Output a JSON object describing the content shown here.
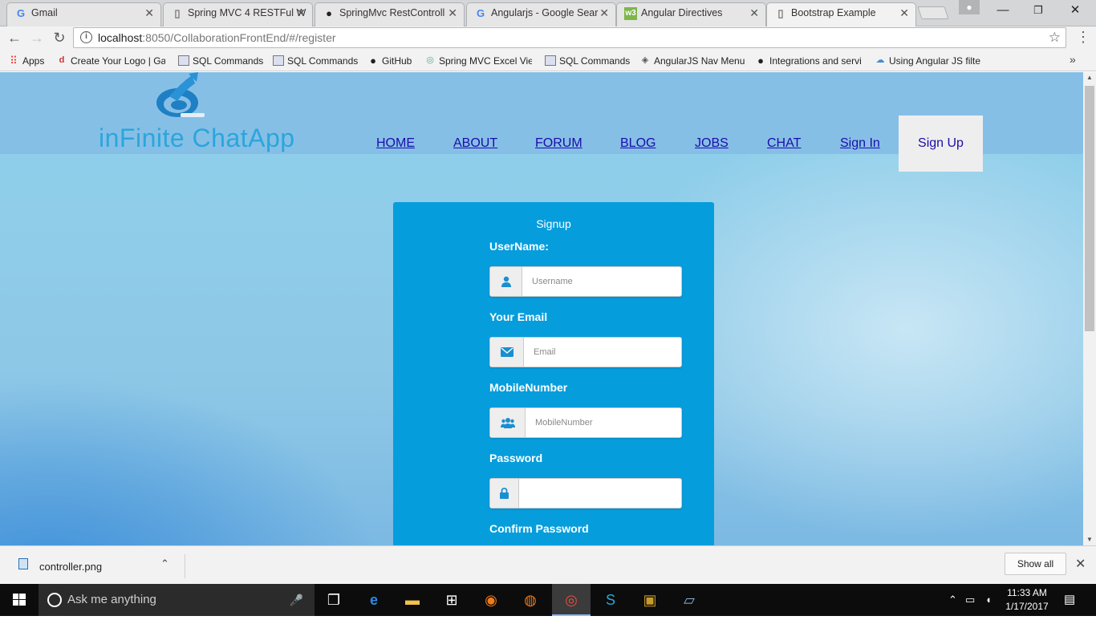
{
  "tabs": [
    {
      "icon": "google-icon",
      "label": "Gmail"
    },
    {
      "icon": "document-icon",
      "label": "Spring MVC 4 RESTFul W"
    },
    {
      "icon": "github-icon",
      "label": "SpringMvc RestControll"
    },
    {
      "icon": "google-icon",
      "label": "Angularjs - Google Sear"
    },
    {
      "icon": "w3-icon",
      "label": "Angular Directives"
    },
    {
      "icon": "document-icon",
      "label": "Bootstrap Example"
    }
  ],
  "address": {
    "host": "localhost",
    "path": ":8050/CollaborationFrontEnd/#/register"
  },
  "bookmarks": [
    {
      "label": "Apps"
    },
    {
      "label": "Create Your Logo | Ga"
    },
    {
      "label": "SQL Commands"
    },
    {
      "label": "SQL Commands"
    },
    {
      "label": "GitHub"
    },
    {
      "label": "Spring MVC Excel View"
    },
    {
      "label": "SQL Commands"
    },
    {
      "label": "AngularJS Nav Menu"
    },
    {
      "label": "Integrations and servi"
    },
    {
      "label": "Using Angular JS filte"
    }
  ],
  "site": {
    "logo_text": "inFinite ChatApp",
    "nav": [
      "HOME",
      "ABOUT",
      "FORUM",
      "BLOG",
      "JOBS",
      "CHAT",
      "Sign In"
    ],
    "nav_active": "Sign Up"
  },
  "form": {
    "title": "Signup",
    "username_label": "UserName:",
    "username_placeholder": "Username",
    "email_label": "Your Email",
    "email_placeholder": "Email",
    "mobile_label": "MobileNumber",
    "mobile_placeholder": "MobileNumber",
    "password_label": "Password",
    "confirm_label": "Confirm Password"
  },
  "download": {
    "filename": "controller.png",
    "show_all": "Show all"
  },
  "taskbar": {
    "search_placeholder": "Ask me anything",
    "time": "11:33 AM",
    "date": "1/17/2017"
  },
  "colors": {
    "card": "#069ddc",
    "nav_link": "#1a0dab",
    "logo": "#2aa6dc"
  }
}
